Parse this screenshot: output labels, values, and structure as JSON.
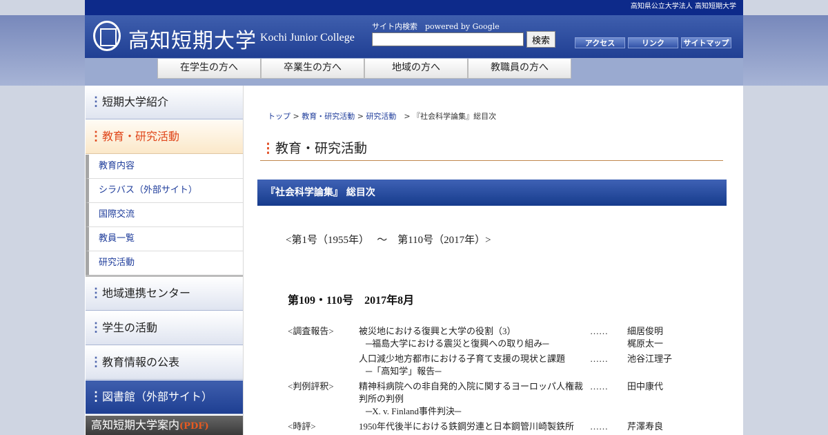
{
  "topbar": {
    "org_text": "高知県公立大学法人 高知短期大学"
  },
  "header": {
    "logo_jp": "高知短期大学",
    "logo_en": "Kochi Junior College",
    "search_label": "サイト内検索　powered by Google",
    "search_value": "",
    "search_button": "検索",
    "tools": [
      "アクセス",
      "リンク",
      "サイトマップ"
    ]
  },
  "nav": [
    "在学生の方へ",
    "卒業生の方へ",
    "地域の方へ",
    "教職員の方へ"
  ],
  "sidebar": {
    "menu1": "短期大学紹介",
    "menu2": "教育・研究活動",
    "submenu": [
      "教育内容",
      "シラバス（外部サイト）",
      "国際交流",
      "教員一覧",
      "研究活動"
    ],
    "menu3": "地域連携センター",
    "menu4": "学生の活動",
    "menu5": "教育情報の公表",
    "menu6": "図書館（外部サイト）",
    "banner_text": "高知短期大学案内",
    "banner_pdf": "(PDF)"
  },
  "breadcrumb": {
    "top": "トップ",
    "sep": " > ",
    "edu": "教育・研究活動",
    "research": "研究活動",
    "current_sep": "　>  ",
    "current": "『社会科学論集』総目次"
  },
  "main": {
    "heading": "教育・研究活動",
    "section_title": "『社会科学論集』 総目次",
    "range": "<第1号（1955年）　 ～　第110号（2017年）>",
    "issue_heading": "第109・110号　2017年8月",
    "toc": {
      "cat1": "<調査報告>",
      "t1a": "被災地における復興と大学の役割（3）",
      "t1b": "─福島大学における震災と復興への取り組み─",
      "a1a": "細居俊明",
      "a1b": "梶原太一",
      "t2a": "人口減少地方都市における子育て支援の現状と課題",
      "t2b": "─「高知学」報告─",
      "a2": "池谷江理子",
      "cat2": "<判例評釈>",
      "t3a": "精神科病院への非自発的入院に関するヨーロッパ人権裁",
      "t3b": "判所の判例",
      "t3c": "─X. v. Finland事件判決─",
      "a3": "田中康代",
      "cat3": "<時評>",
      "t4a": " 1950年代後半における鉄鋼労連と日本鋼管川崎製鉄所",
      "a4": "芹澤寿良",
      "dots": "……"
    }
  }
}
